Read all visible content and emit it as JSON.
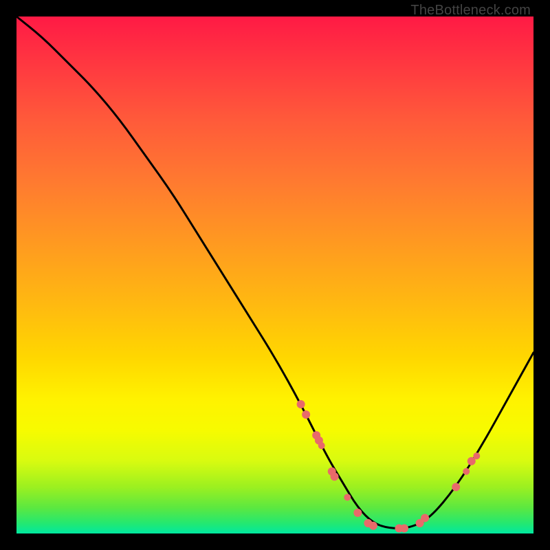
{
  "watermark": "TheBottleneck.com",
  "chart_data": {
    "type": "line",
    "title": "",
    "xlabel": "",
    "ylabel": "",
    "xlim": [
      0,
      100
    ],
    "ylim": [
      0,
      100
    ],
    "grid": false,
    "series": [
      {
        "name": "bottleneck-curve",
        "x": [
          0,
          5,
          10,
          15,
          20,
          25,
          30,
          35,
          40,
          45,
          50,
          55,
          60,
          63,
          66,
          69,
          72,
          76,
          80,
          85,
          90,
          95,
          100
        ],
        "values": [
          100,
          96,
          91,
          86,
          80,
          73,
          66,
          58,
          50,
          42,
          34,
          25,
          15,
          10,
          5,
          2,
          1,
          1,
          3,
          9,
          17,
          26,
          35
        ]
      }
    ],
    "markers": {
      "name": "highlighted-points",
      "color": "#e86a6a",
      "points": [
        {
          "x": 55,
          "y": 25,
          "r": 6
        },
        {
          "x": 56,
          "y": 23,
          "r": 6
        },
        {
          "x": 58,
          "y": 19,
          "r": 6
        },
        {
          "x": 58.5,
          "y": 18,
          "r": 6
        },
        {
          "x": 59,
          "y": 17,
          "r": 5
        },
        {
          "x": 61,
          "y": 12,
          "r": 6
        },
        {
          "x": 61.5,
          "y": 11,
          "r": 6
        },
        {
          "x": 64,
          "y": 7,
          "r": 5
        },
        {
          "x": 66,
          "y": 4,
          "r": 6
        },
        {
          "x": 68,
          "y": 2,
          "r": 6
        },
        {
          "x": 69,
          "y": 1.5,
          "r": 6
        },
        {
          "x": 74,
          "y": 1,
          "r": 6
        },
        {
          "x": 75,
          "y": 1,
          "r": 6
        },
        {
          "x": 78,
          "y": 2,
          "r": 6
        },
        {
          "x": 79,
          "y": 3,
          "r": 6
        },
        {
          "x": 85,
          "y": 9,
          "r": 6
        },
        {
          "x": 87,
          "y": 12,
          "r": 5
        },
        {
          "x": 88,
          "y": 14,
          "r": 6
        },
        {
          "x": 89,
          "y": 15,
          "r": 5
        }
      ]
    }
  }
}
